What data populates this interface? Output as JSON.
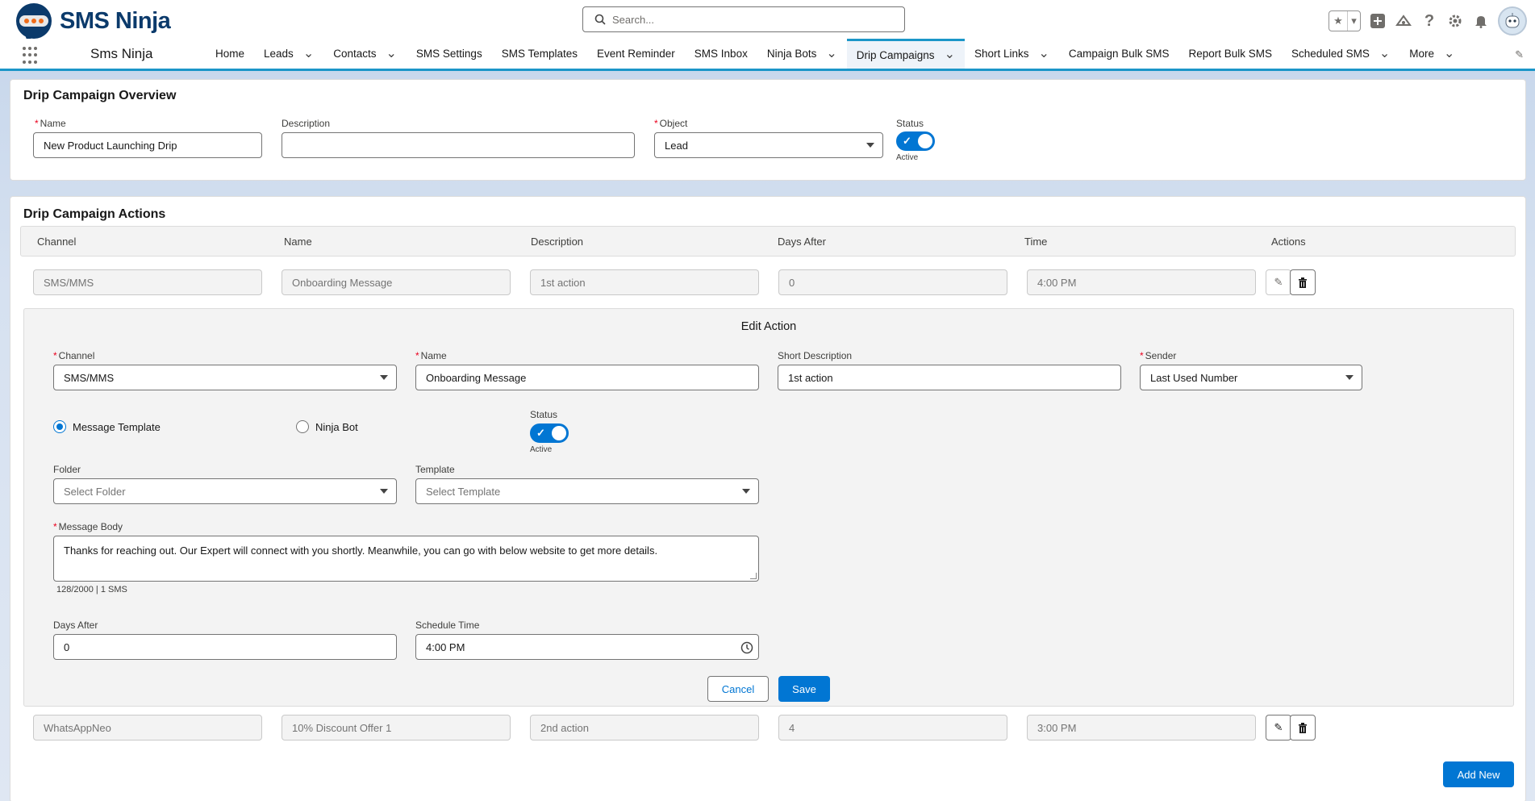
{
  "header": {
    "logo_text": "SMS Ninja",
    "search_placeholder": "Search..."
  },
  "nav": {
    "app_name": "Sms Ninja",
    "items": [
      {
        "label": "Home",
        "dropdown": false
      },
      {
        "label": "Leads",
        "dropdown": true
      },
      {
        "label": "Contacts",
        "dropdown": true
      },
      {
        "label": "SMS Settings",
        "dropdown": false
      },
      {
        "label": "SMS Templates",
        "dropdown": false
      },
      {
        "label": "Event Reminder",
        "dropdown": false
      },
      {
        "label": "SMS Inbox",
        "dropdown": false
      },
      {
        "label": "Ninja Bots",
        "dropdown": true
      },
      {
        "label": "Drip Campaigns",
        "dropdown": true,
        "active": true
      },
      {
        "label": "Short Links",
        "dropdown": true
      },
      {
        "label": "Campaign Bulk SMS",
        "dropdown": false
      },
      {
        "label": "Report Bulk SMS",
        "dropdown": false
      },
      {
        "label": "Scheduled SMS",
        "dropdown": true
      },
      {
        "label": "More",
        "dropdown": true
      }
    ]
  },
  "overview": {
    "title": "Drip Campaign Overview",
    "name_label": "Name",
    "name_value": "New Product Launching Drip",
    "description_label": "Description",
    "description_value": "",
    "object_label": "Object",
    "object_value": "Lead",
    "status_label": "Status",
    "status_caption": "Active"
  },
  "actions": {
    "title": "Drip Campaign Actions",
    "columns": [
      "Channel",
      "Name",
      "Description",
      "Days After",
      "Time",
      "Actions"
    ],
    "rows": [
      {
        "channel": "SMS/MMS",
        "name": "Onboarding Message",
        "description": "1st action",
        "days_after": "0",
        "time": "4:00 PM"
      },
      {
        "channel": "WhatsAppNeo",
        "name": "10% Discount Offer 1",
        "description": "2nd action",
        "days_after": "4",
        "time": "3:00 PM"
      }
    ],
    "add_new_label": "Add New"
  },
  "edit": {
    "title": "Edit Action",
    "channel_label": "Channel",
    "channel_value": "SMS/MMS",
    "name_label": "Name",
    "name_value": "Onboarding Message",
    "short_desc_label": "Short Description",
    "short_desc_value": "1st action",
    "sender_label": "Sender",
    "sender_value": "Last Used Number",
    "radio_template_label": "Message Template",
    "radio_bot_label": "Ninja Bot",
    "status_label": "Status",
    "status_caption": "Active",
    "folder_label": "Folder",
    "folder_placeholder": "Select Folder",
    "template_label": "Template",
    "template_placeholder": "Select Template",
    "body_label": "Message Body",
    "body_value": "Thanks for reaching out. Our Expert will connect with you shortly. Meanwhile, you can go with below website to get more details.",
    "counter": "128/2000 | 1 SMS",
    "days_after_label": "Days After",
    "days_after_value": "0",
    "schedule_label": "Schedule Time",
    "schedule_value": "4:00 PM",
    "cancel_label": "Cancel",
    "save_label": "Save"
  },
  "colors": {
    "brand": "#0176d3",
    "nav_accent": "#1b96c8",
    "logo": "#0b3a6b",
    "required": "#ea001e"
  }
}
